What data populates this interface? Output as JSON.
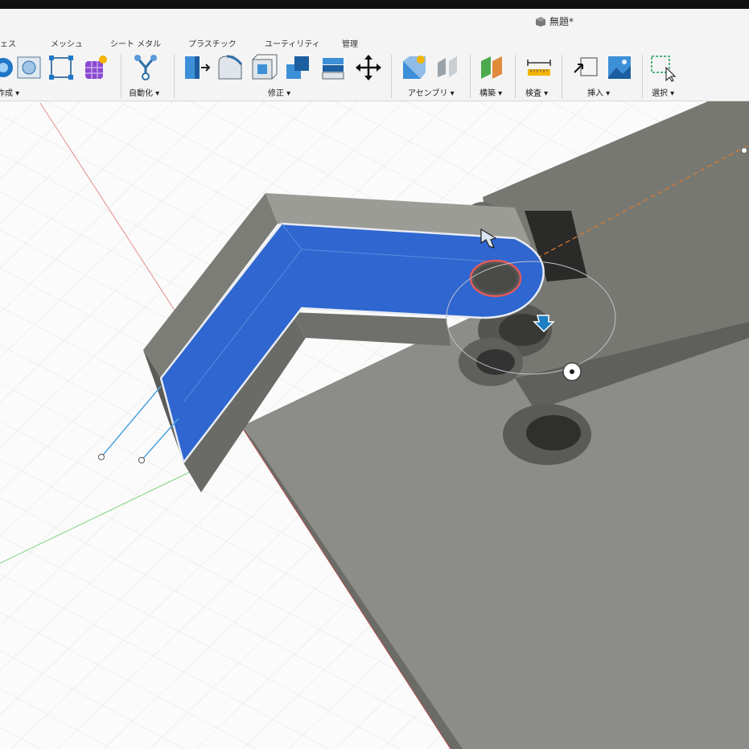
{
  "document": {
    "title": "無題*"
  },
  "tabs": [
    {
      "id": "surface",
      "label": "ェス"
    },
    {
      "id": "mesh",
      "label": "メッシュ"
    },
    {
      "id": "sheetmetal",
      "label": "シート メタル"
    },
    {
      "id": "plastic",
      "label": "プラスチック"
    },
    {
      "id": "utility",
      "label": "ユーティリティ"
    },
    {
      "id": "manage",
      "label": "管理"
    }
  ],
  "groups": {
    "create": "作成 ▾",
    "automate": "自動化 ▾",
    "modify": "修正 ▾",
    "assemble": "アセンブリ ▾",
    "construct": "構築 ▾",
    "inspect": "検査 ▾",
    "insert": "挿入 ▾",
    "select": "選択 ▾"
  },
  "icons": [
    "cube-icon",
    "box-icon",
    "sphere-icon",
    "sketch-icon",
    "form-icon",
    "automate-icon",
    "pressPull-icon",
    "fillet-icon",
    "shell-icon",
    "combine-icon",
    "align-icon",
    "move-icon",
    "newComponent-icon",
    "joint-icon",
    "plane-icon",
    "measure-icon",
    "insertDerive-icon",
    "decal-icon",
    "selectWindow-icon"
  ],
  "colors": {
    "selection": "#2f66d0",
    "body": "#8e8f8a",
    "accent": "#1e7fc4"
  }
}
